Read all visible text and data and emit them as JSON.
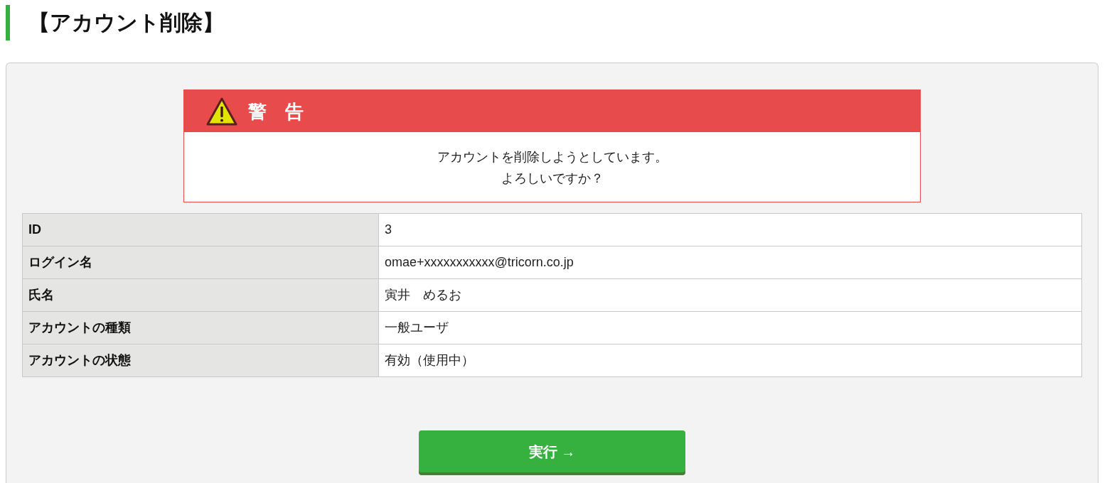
{
  "page": {
    "title": "【アカウント削除】"
  },
  "warning": {
    "title": "警　告",
    "message_lines": [
      "アカウントを削除しようとしています。",
      "よろしいですか？"
    ]
  },
  "details": [
    {
      "label": "ID",
      "value": "3"
    },
    {
      "label": "ログイン名",
      "value": "omae+xxxxxxxxxxx@tricorn.co.jp"
    },
    {
      "label": "氏名",
      "value": "寅井　めるお"
    },
    {
      "label": "アカウントの種類",
      "value": "一般ユーザ"
    },
    {
      "label": "アカウントの状態",
      "value": "有効（使用中）"
    }
  ],
  "submit_button": {
    "label": "実行 →"
  }
}
